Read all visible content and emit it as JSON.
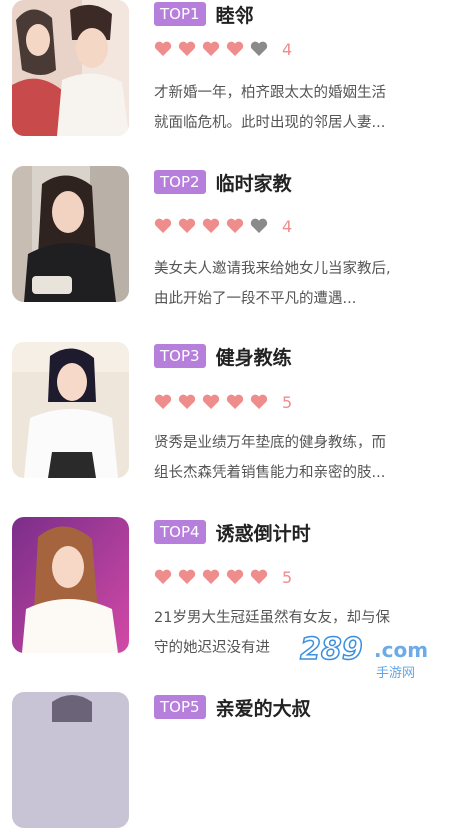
{
  "items": [
    {
      "rank": "TOP1",
      "title": "睦邻",
      "score": "4",
      "hearts_filled": 4,
      "hearts_total": 5,
      "desc_line1": "才新婚一年，柏齐跟太太的婚姻生活",
      "desc_line2": "就面临危机。此时出现的邻居人妻..."
    },
    {
      "rank": "TOP2",
      "title": "临时家教",
      "score": "4",
      "hearts_filled": 4,
      "hearts_total": 5,
      "desc_line1": "美女夫人邀请我来给她女儿当家教后,",
      "desc_line2": "由此开始了一段不平凡的遭遇..."
    },
    {
      "rank": "TOP3",
      "title": "健身教练",
      "score": "5",
      "hearts_filled": 5,
      "hearts_total": 5,
      "desc_line1": "贤秀是业绩万年垫底的健身教练，而",
      "desc_line2": "组长杰森凭着销售能力和亲密的肢..."
    },
    {
      "rank": "TOP4",
      "title": "诱惑倒计时",
      "score": "5",
      "hearts_filled": 5,
      "hearts_total": 5,
      "desc_line1": "21岁男大生冠廷虽然有女友，却与保",
      "desc_line2": "守的她迟迟没有进"
    },
    {
      "rank": "TOP5",
      "title": "亲爱的大叔",
      "score": "",
      "hearts_filled": 0,
      "hearts_total": 0,
      "desc_line1": "",
      "desc_line2": ""
    }
  ],
  "watermark": {
    "num": "289",
    "domain": ".com",
    "sub": "手游网"
  },
  "colors": {
    "badge": "#b77fdc",
    "heart_on": "#ef8d8d",
    "heart_off": "#8a8a8a",
    "score": "#ef8d8d"
  }
}
